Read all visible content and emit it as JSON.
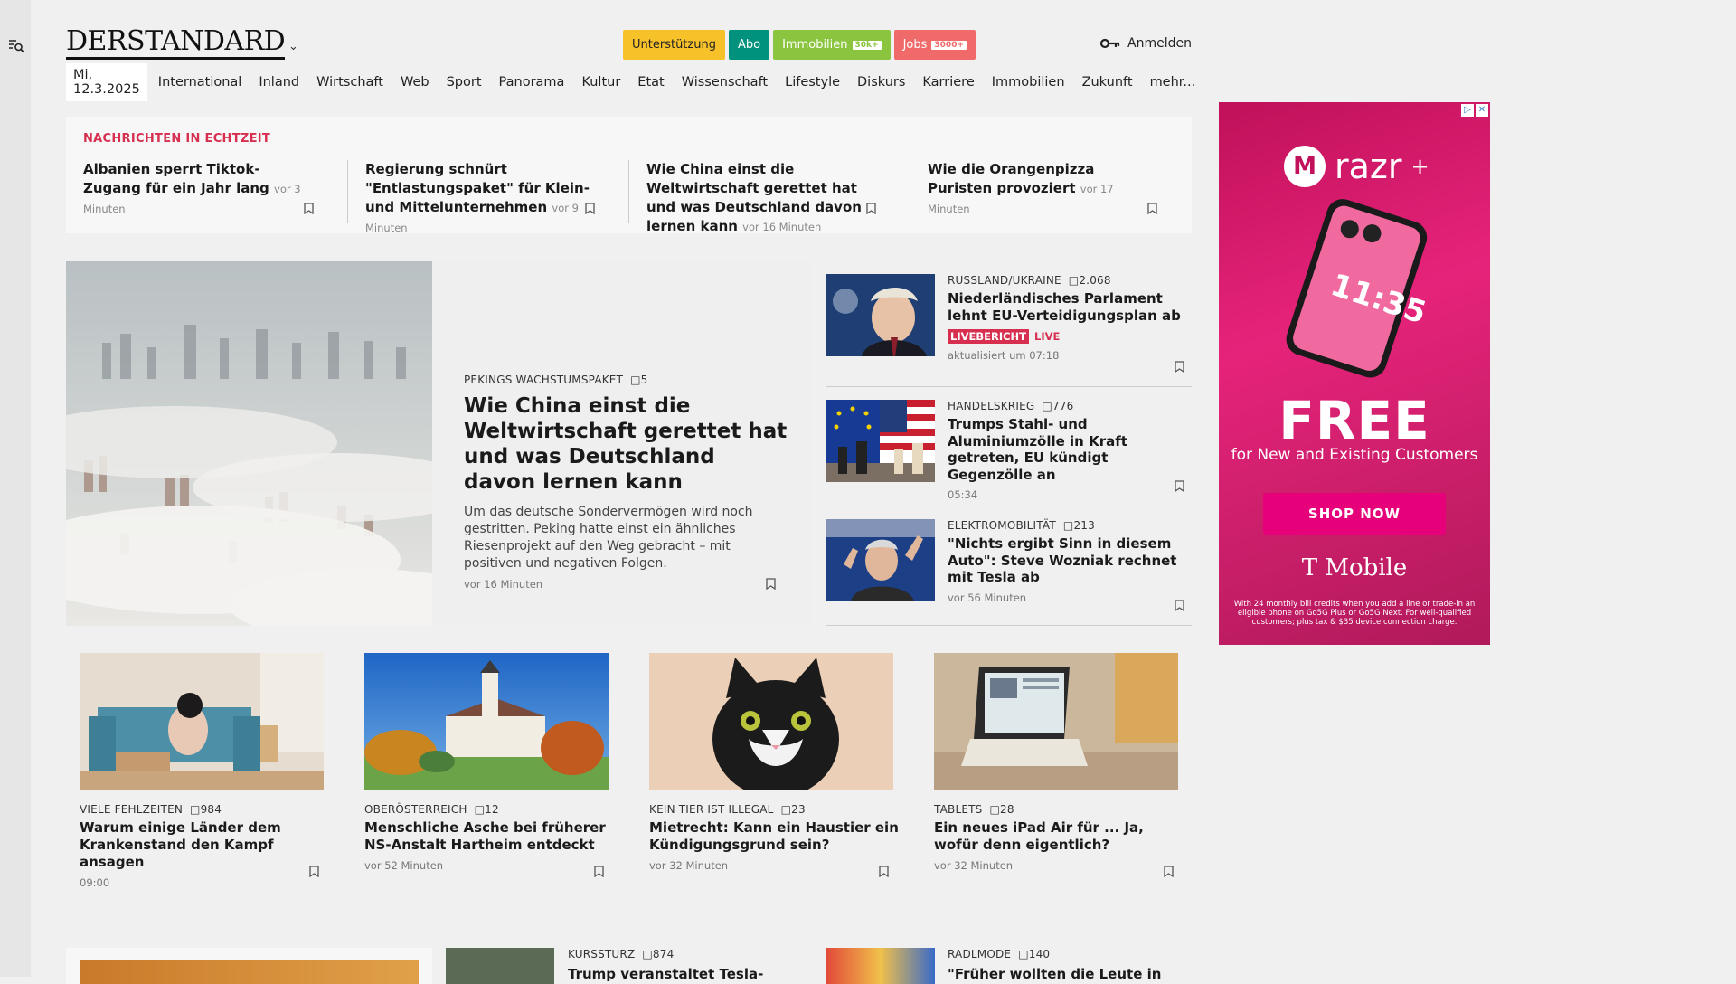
{
  "header": {
    "logo": "DERSTANDARD",
    "pills": [
      {
        "label": "Unterstützung",
        "tag": ""
      },
      {
        "label": "Abo",
        "tag": ""
      },
      {
        "label": "Immobilien",
        "tag": "30k+"
      },
      {
        "label": "Jobs",
        "tag": "3000+"
      }
    ],
    "login": "Anmelden"
  },
  "nav": {
    "date": "Mi, 12.3.2025",
    "items": [
      "International",
      "Inland",
      "Wirtschaft",
      "Web",
      "Sport",
      "Panorama",
      "Kultur",
      "Etat",
      "Wissenschaft",
      "Lifestyle",
      "Diskurs",
      "Karriere",
      "Immobilien",
      "Zukunft",
      "mehr..."
    ]
  },
  "ticker": {
    "heading": "NACHRICHTEN IN ECHTZEIT",
    "items": [
      {
        "title": "Albanien sperrt Tiktok-Zugang für ein Jahr lang",
        "time": "vor 3 Minuten"
      },
      {
        "title": "Regierung schnürt \"Entlastungspaket\" für Klein- und Mittelunternehmen",
        "time": "vor 9 Minuten"
      },
      {
        "title": "Wie China einst die Weltwirtschaft gerettet hat und was Deutschland davon lernen kann",
        "time": "vor 16 Minuten"
      },
      {
        "title": "Wie die Orangenpizza Puristen provoziert",
        "time": "vor 17 Minuten"
      }
    ]
  },
  "hero": {
    "kicker": "PEKINGS WACHSTUMSPAKET",
    "comments": "5",
    "title": "Wie China einst die Weltwirtschaft gerettet hat und was Deutschland davon lernen kann",
    "teaser": "Um das deutsche Sondervermögen wird noch gestritten. Peking hatte einst ein ähnliches Riesenprojekt auf den Weg gebracht – mit positiven und negativen Folgen.",
    "time": "vor 16 Minuten"
  },
  "side": [
    {
      "kicker": "RUSSLAND/UKRAINE",
      "comments": "2.068",
      "title": "Niederländisches Parlament lehnt EU-Verteidigungsplan ab",
      "badge": "LIVEBERICHT",
      "live": "LIVE",
      "time": "aktualisiert um 07:18"
    },
    {
      "kicker": "HANDELSKRIEG",
      "comments": "776",
      "title": "Trumps Stahl- und Aluminiumzölle in Kraft getreten, EU kündigt Gegenzölle an",
      "time": "05:34"
    },
    {
      "kicker": "ELEKTROMOBILITÄT",
      "comments": "213",
      "title": "\"Nichts ergibt Sinn in diesem Auto\": Steve Wozniak rechnet mit Tesla ab",
      "time": "vor 56 Minuten"
    }
  ],
  "cards": [
    {
      "kicker": "VIELE FEHLZEITEN",
      "comments": "984",
      "title": "Warum einige Länder dem Krankenstand den Kampf ansagen",
      "time": "09:00"
    },
    {
      "kicker": "OBERÖSTERREICH",
      "comments": "12",
      "title": "Menschliche Asche bei früherer NS-Anstalt Hartheim entdeckt",
      "time": "vor 52 Minuten"
    },
    {
      "kicker": "KEIN TIER IST ILLEGAL",
      "comments": "23",
      "title": "Mietrecht: Kann ein Haustier ein Kündigungsgrund sein?",
      "time": "vor 32 Minuten"
    },
    {
      "kicker": "TABLETS",
      "comments": "28",
      "title": "Ein neues iPad Air für ... Ja, wofür denn eigentlich?",
      "time": "vor 32 Minuten"
    }
  ],
  "bottom": [
    {
      "kicker": "KURSSTURZ",
      "comments": "874",
      "title": "Trump veranstaltet Tesla-"
    },
    {
      "kicker": "RADLMODE",
      "comments": "140",
      "title": "\"Früher wollten die Leute in"
    }
  ],
  "ad": {
    "brand": "razr",
    "brand_sup": "+",
    "phone_time": "11:35",
    "headline": "FREE",
    "sub": "for New and Existing Customers",
    "cta": "SHOP NOW",
    "advertiser": "T Mobile",
    "fine": "With 24 monthly bill credits when you add a line or trade-in an eligible phone on Go5G Plus or Go5G Next. For well-qualified customers; plus tax & $35 device connection charge."
  },
  "colors": {
    "accent_red": "#d62f4f",
    "unterstuetzung": "#f7c229",
    "abo": "#00927c",
    "immobilien": "#8bc53f",
    "jobs": "#f06a6a"
  }
}
